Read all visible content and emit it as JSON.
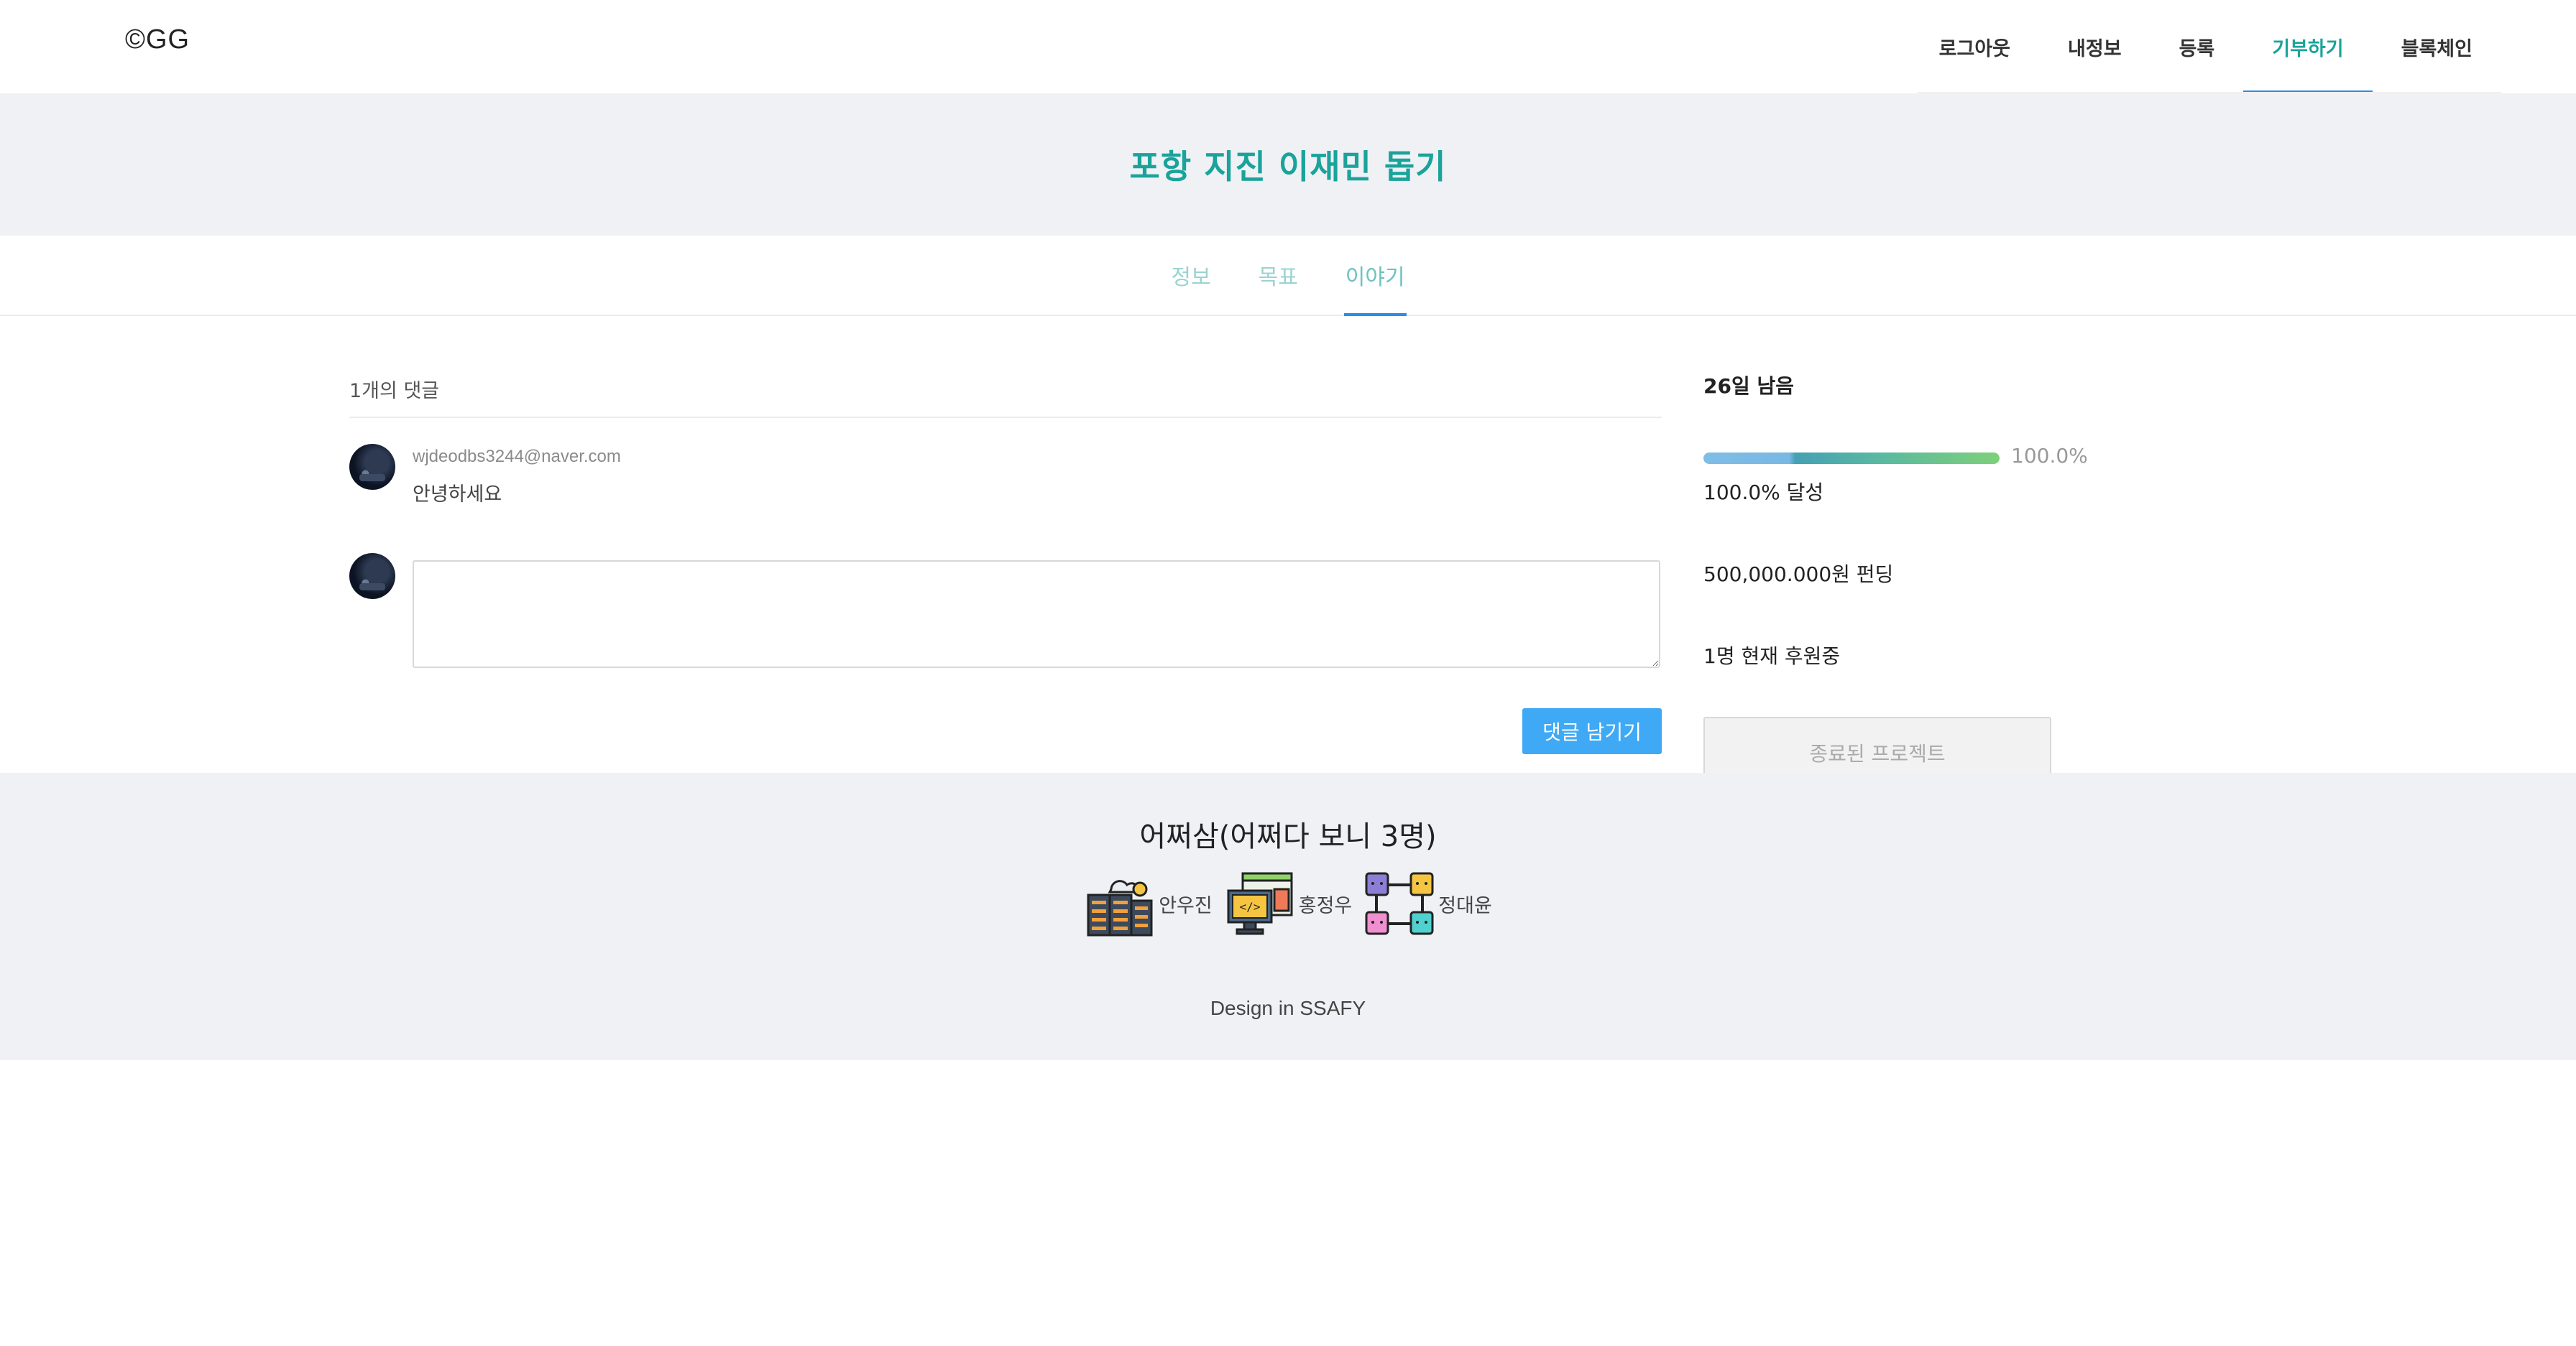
{
  "header": {
    "logo": "©GG",
    "nav": [
      {
        "label": "로그아웃"
      },
      {
        "label": "내정보"
      },
      {
        "label": "등록"
      },
      {
        "label": "기부하기"
      },
      {
        "label": "블록체인"
      }
    ],
    "active_nav": "기부하기"
  },
  "banner": {
    "title": "포항 지진 이재민 돕기"
  },
  "tabs": [
    {
      "label": "정보"
    },
    {
      "label": "목표"
    },
    {
      "label": "이야기"
    }
  ],
  "active_tab": "이야기",
  "comments": {
    "count_label": "1개의 댓글",
    "items": [
      {
        "email": "wjdeodbs3244@naver.com",
        "text": "안녕하세요"
      }
    ],
    "input_value": "",
    "submit_label": "댓글 남기기"
  },
  "status": {
    "days_left": "26일 남음",
    "progress_fraction": 1.0,
    "progress_label": "100.0%",
    "achieved": "100.0% 달성",
    "funding": "500,000.000원 펀딩",
    "supporters": "1명 현재 후원중",
    "ended_label": "종료된 프로젝트"
  },
  "footer": {
    "team_title": "어쩌삼(어쩌다 보니 3명)",
    "members": [
      {
        "name": "안우진",
        "icon": "server-cloud-icon"
      },
      {
        "name": "홍정우",
        "icon": "code-monitor-icon"
      },
      {
        "name": "정대윤",
        "icon": "blocks-network-icon"
      }
    ],
    "credit": "Design in SSAFY"
  },
  "colors": {
    "accent": "#1aa39a",
    "nav_underline": "#2b8ce8",
    "button": "#3fa9f5",
    "band_background": "#eff1f5"
  }
}
